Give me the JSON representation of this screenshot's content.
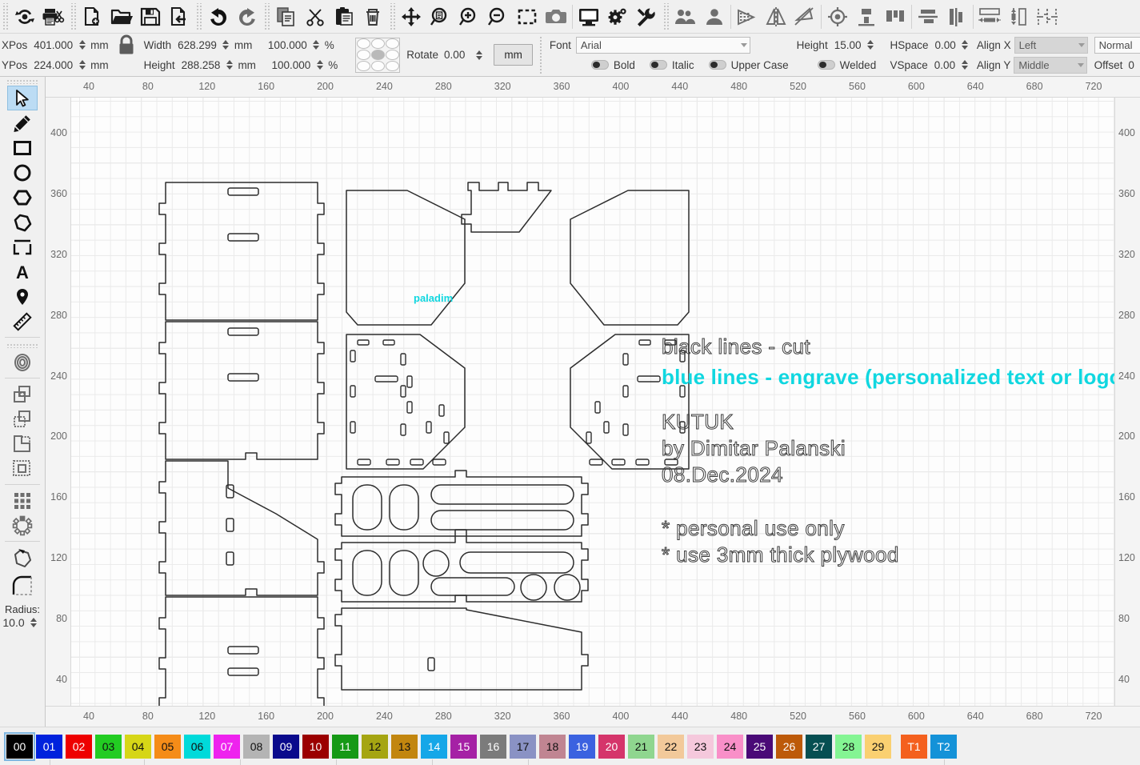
{
  "app": {
    "name": "laser-cutter-layout-editor"
  },
  "toolbar_top": {
    "groups": [
      {
        "buttons": [
          {
            "name": "refresh-icon",
            "label": "Refresh"
          },
          {
            "name": "print-cut-icon",
            "label": "Print and Cut"
          }
        ]
      },
      {
        "buttons": [
          {
            "name": "new-file-icon",
            "label": "New"
          },
          {
            "name": "open-folder-icon",
            "label": "Open"
          },
          {
            "name": "save-disk-icon",
            "label": "Save"
          },
          {
            "name": "export-file-icon",
            "label": "Export"
          }
        ]
      },
      {
        "buttons": [
          {
            "name": "undo-icon",
            "label": "Undo"
          },
          {
            "name": "redo-icon",
            "label": "Redo"
          }
        ]
      },
      {
        "buttons": [
          {
            "name": "copy-icon",
            "label": "Copy"
          },
          {
            "name": "cut-scissors-icon",
            "label": "Cut"
          },
          {
            "name": "paste-clipboard-icon",
            "label": "Paste"
          },
          {
            "name": "delete-trash-icon",
            "label": "Delete"
          }
        ]
      },
      {
        "buttons": [
          {
            "name": "pan-move-icon",
            "label": "Pan"
          },
          {
            "name": "zoom-fit-page-icon",
            "label": "Zoom to Page"
          },
          {
            "name": "zoom-in-icon",
            "label": "Zoom In"
          },
          {
            "name": "zoom-out-icon",
            "label": "Zoom Out"
          },
          {
            "name": "zoom-selection-icon",
            "label": "Zoom to Selection"
          },
          {
            "name": "camera-icon",
            "label": "Camera"
          },
          {
            "name": "monitor-preview-icon",
            "label": "Preview"
          },
          {
            "name": "settings-gear-icon",
            "label": "Settings"
          },
          {
            "name": "tools-wrench-icon",
            "label": "Tools"
          }
        ]
      },
      {
        "buttons": [
          {
            "name": "group-objects-icon",
            "label": "Group"
          },
          {
            "name": "ungroup-objects-icon",
            "label": "Ungroup"
          }
        ]
      },
      {
        "buttons": [
          {
            "name": "mirror-horizontal-icon",
            "label": "Mirror Horizontal"
          },
          {
            "name": "mirror-vertical-icon",
            "label": "Mirror Vertical"
          },
          {
            "name": "rotate-shape-icon",
            "label": "Rotate"
          }
        ]
      },
      {
        "buttons": [
          {
            "name": "center-target-icon",
            "label": "Center"
          },
          {
            "name": "align-top-icon",
            "label": "Align Top"
          },
          {
            "name": "align-bottom-icon",
            "label": "Align Bottom"
          }
        ]
      },
      {
        "buttons": [
          {
            "name": "align-center-horizontal-icon",
            "label": "Align Center Horizontal"
          },
          {
            "name": "align-center-vertical-icon",
            "label": "Align Center Vertical"
          }
        ]
      },
      {
        "buttons": [
          {
            "name": "distribute-horizontal-icon",
            "label": "Distribute Horizontal"
          },
          {
            "name": "distribute-vertical-icon",
            "label": "Distribute Vertical"
          },
          {
            "name": "spacing-icon",
            "label": "Spacing"
          }
        ]
      }
    ]
  },
  "properties": {
    "xpos": {
      "label": "XPos",
      "value": "401.000",
      "unit": "mm"
    },
    "ypos": {
      "label": "YPos",
      "value": "224.000",
      "unit": "mm"
    },
    "lock": {
      "name": "aspect-lock-icon",
      "state": "locked"
    },
    "width": {
      "label": "Width",
      "value": "628.299",
      "unit": "mm",
      "percent": "100.000",
      "percent_unit": "%"
    },
    "height": {
      "label": "Height",
      "value": "288.258",
      "unit": "mm",
      "percent": "100.000",
      "percent_unit": "%"
    },
    "rotate": {
      "label": "Rotate",
      "value": "0.00"
    },
    "unit_button": "mm",
    "anchor_grid": {
      "selected_index": 4
    }
  },
  "text_properties": {
    "font": {
      "label": "Font",
      "value": "Arial"
    },
    "bold": {
      "label": "Bold",
      "on": false
    },
    "italic": {
      "label": "Italic",
      "on": false
    },
    "upper_case": {
      "label": "Upper Case",
      "on": false
    },
    "welded": {
      "label": "Welded",
      "on": false
    },
    "height": {
      "label": "Height",
      "value": "15.00"
    },
    "hspace": {
      "label": "HSpace",
      "value": "0.00"
    },
    "vspace": {
      "label": "VSpace",
      "value": "0.00"
    },
    "align_x": {
      "label": "Align X",
      "value": "Left"
    },
    "align_y": {
      "label": "Align Y",
      "value": "Middle"
    },
    "style": {
      "value": "Normal"
    },
    "offset": {
      "label": "Offset",
      "value": "0"
    }
  },
  "tool_rail": {
    "tools": [
      {
        "name": "select-arrow-tool",
        "label": "Select",
        "selected": true
      },
      {
        "name": "pencil-draw-tool",
        "label": "Draw"
      },
      {
        "name": "rectangle-tool",
        "label": "Rectangle"
      },
      {
        "name": "ellipse-tool",
        "label": "Ellipse"
      },
      {
        "name": "polygon-tool",
        "label": "Polygon"
      },
      {
        "name": "freeform-polygon-tool",
        "label": "Freeform"
      },
      {
        "name": "bounding-box-tool",
        "label": "Bounding Box"
      },
      {
        "name": "text-tool",
        "label": "Text"
      },
      {
        "name": "marker-pin-tool",
        "label": "Marker"
      },
      {
        "name": "measure-ruler-tool",
        "label": "Measure"
      }
    ],
    "tools2": [
      {
        "name": "offset-ring-tool",
        "label": "Offset"
      }
    ],
    "tools3": [
      {
        "name": "boolean-union-tool",
        "label": "Union"
      },
      {
        "name": "boolean-subtract-tool",
        "label": "Subtract"
      },
      {
        "name": "boolean-intersect-tool",
        "label": "Intersect"
      },
      {
        "name": "boolean-exclude-tool",
        "label": "Exclude"
      }
    ],
    "tools4": [
      {
        "name": "grid-array-tool",
        "label": "Grid Array"
      },
      {
        "name": "circular-array-tool",
        "label": "Circular Array"
      }
    ],
    "tools5": [
      {
        "name": "node-edit-tool",
        "label": "Edit Nodes"
      },
      {
        "name": "fillet-radius-tool",
        "label": "Fillet"
      }
    ],
    "radius": {
      "label": "Radius:",
      "value": "10.0"
    }
  },
  "canvas": {
    "ruler_unit": "mm",
    "top_ticks": [
      40,
      80,
      120,
      160,
      200,
      240,
      280,
      320,
      360,
      400,
      440,
      480,
      520,
      560,
      600,
      640,
      680,
      720
    ],
    "bottom_ticks": [
      40,
      80,
      120,
      160,
      200,
      240,
      280,
      320,
      360,
      400,
      440,
      480,
      520,
      560,
      600,
      640,
      680,
      720
    ],
    "left_ticks": [
      400,
      360,
      320,
      280,
      240,
      200,
      160,
      120,
      80,
      40
    ],
    "right_ticks": [
      400,
      360,
      320,
      280,
      240,
      200,
      160,
      120,
      80,
      40
    ],
    "annotations": [
      {
        "name": "note-black-lines",
        "text": "black lines - cut",
        "style": "hollow"
      },
      {
        "name": "note-blue-lines",
        "text": "blue lines - engrave (personalized text or logo)",
        "style": "cyan"
      },
      {
        "name": "note-project-title",
        "text": "KUTUK",
        "style": "hollow"
      },
      {
        "name": "note-author",
        "text": "by Dimitar Palanski",
        "style": "hollow"
      },
      {
        "name": "note-date",
        "text": "08.Dec.2024",
        "style": "hollow"
      },
      {
        "name": "note-personal-use",
        "text": "* personal use only",
        "style": "hollow"
      },
      {
        "name": "note-material",
        "text": "* use 3mm thick plywood",
        "style": "hollow"
      }
    ],
    "engraved_logo": {
      "name": "engrave-logo-text",
      "text": "paladim",
      "color": "#10d7e0"
    },
    "cut_color": "#2d2d2d",
    "engrave_color": "#10d7e0"
  },
  "palette": {
    "swatches": [
      {
        "label": "00",
        "bg": "#000000",
        "fg": "#ffffff",
        "selected": true
      },
      {
        "label": "01",
        "bg": "#0022dd",
        "fg": "#ffffff"
      },
      {
        "label": "02",
        "bg": "#ee0000",
        "fg": "#ffffff"
      },
      {
        "label": "03",
        "bg": "#22cc22",
        "fg": "#111111"
      },
      {
        "label": "04",
        "bg": "#d6d617",
        "fg": "#111111"
      },
      {
        "label": "05",
        "bg": "#f58c18",
        "fg": "#111111"
      },
      {
        "label": "06",
        "bg": "#00dada",
        "fg": "#111111"
      },
      {
        "label": "07",
        "bg": "#ee22ee",
        "fg": "#ffffff"
      },
      {
        "label": "08",
        "bg": "#b4b4b4",
        "fg": "#111111"
      },
      {
        "label": "09",
        "bg": "#0a0a8c",
        "fg": "#ffffff"
      },
      {
        "label": "10",
        "bg": "#9b0000",
        "fg": "#ffffff"
      },
      {
        "label": "11",
        "bg": "#169916",
        "fg": "#ffffff"
      },
      {
        "label": "12",
        "bg": "#a5a512",
        "fg": "#111111"
      },
      {
        "label": "13",
        "bg": "#c2860f",
        "fg": "#111111"
      },
      {
        "label": "14",
        "bg": "#15a7e8",
        "fg": "#ffffff"
      },
      {
        "label": "15",
        "bg": "#a521a5",
        "fg": "#ffffff"
      },
      {
        "label": "16",
        "bg": "#7b7b7b",
        "fg": "#ffffff"
      },
      {
        "label": "17",
        "bg": "#8a92c4",
        "fg": "#111111"
      },
      {
        "label": "18",
        "bg": "#c08592",
        "fg": "#111111"
      },
      {
        "label": "19",
        "bg": "#3b62e0",
        "fg": "#ffffff"
      },
      {
        "label": "20",
        "bg": "#d5356b",
        "fg": "#ffffff"
      },
      {
        "label": "21",
        "bg": "#8fd68f",
        "fg": "#111111"
      },
      {
        "label": "22",
        "bg": "#f2c99a",
        "fg": "#111111"
      },
      {
        "label": "23",
        "bg": "#f5c8dc",
        "fg": "#111111"
      },
      {
        "label": "24",
        "bg": "#f98fc8",
        "fg": "#111111"
      },
      {
        "label": "25",
        "bg": "#4a0a77",
        "fg": "#ffffff"
      },
      {
        "label": "26",
        "bg": "#bd5a09",
        "fg": "#ffffff"
      },
      {
        "label": "27",
        "bg": "#064f52",
        "fg": "#ffffff"
      },
      {
        "label": "28",
        "bg": "#84f593",
        "fg": "#111111"
      },
      {
        "label": "29",
        "bg": "#fad071",
        "fg": "#111111"
      },
      {
        "label": "T1",
        "bg": "#f4601e",
        "fg": "#ffffff"
      },
      {
        "label": "T2",
        "bg": "#1492d8",
        "fg": "#ffffff"
      }
    ]
  }
}
